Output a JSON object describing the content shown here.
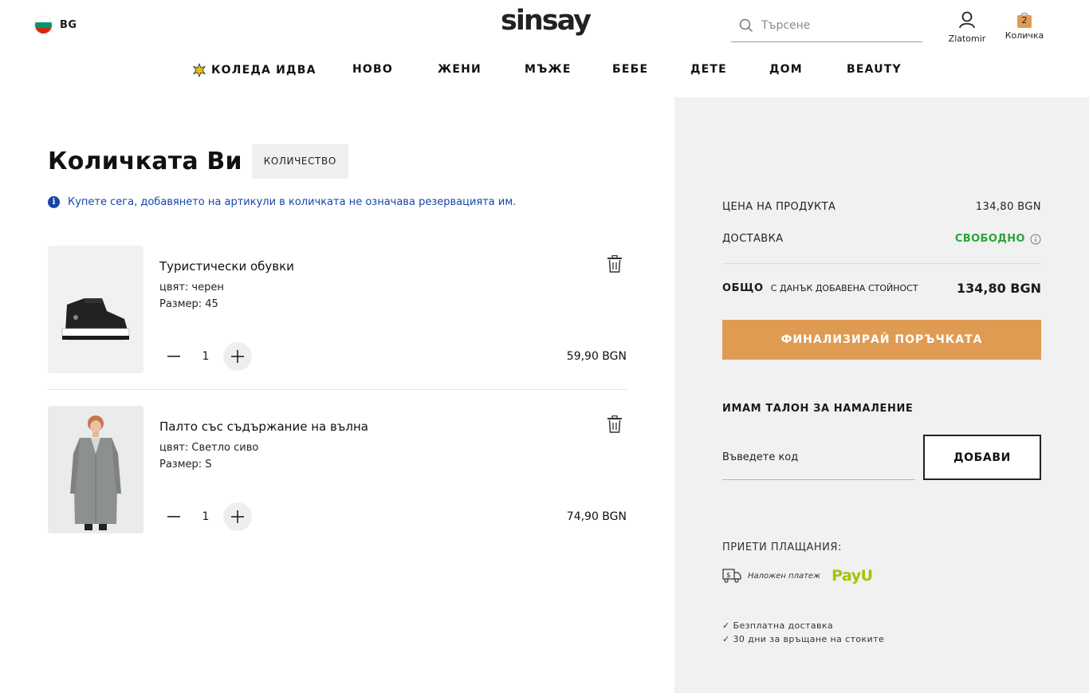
{
  "header": {
    "language": "BG",
    "logo": "sinsay",
    "search_placeholder": "Търсене",
    "account_label": "Zlatomir",
    "cart_label": "Количка",
    "cart_count": "2",
    "flag_colors": [
      "#ffffff",
      "#00966e",
      "#d62612"
    ]
  },
  "nav": {
    "items": [
      {
        "label": "КОЛЕДА ИДВА",
        "icon": "star-icon"
      },
      {
        "label": "НОВО"
      },
      {
        "label": "ЖЕНИ"
      },
      {
        "label": "МЪЖЕ"
      },
      {
        "label": "БЕБЕ"
      },
      {
        "label": "ДЕТЕ"
      },
      {
        "label": "ДОМ"
      },
      {
        "label": "BEAUTY"
      }
    ]
  },
  "cart": {
    "title": "Количката Ви",
    "quantity_badge": "КОЛИЧЕСТВО",
    "notice": "Купете сега, добавянето на артикули в количката не означава резервацията им.",
    "items": [
      {
        "name": "Туристически обувки",
        "color": "цвят: черен",
        "size": "Размер: 45",
        "quantity": "1",
        "price": "59,90 BGN",
        "image": "hiking-boot"
      },
      {
        "name": "Палто със съдържание на вълна",
        "color": "цвят: Светло сиво",
        "size": "Размер: S",
        "quantity": "1",
        "price": "74,90 BGN",
        "image": "grey-wool-coat"
      }
    ]
  },
  "summary": {
    "product_price_label": "ЦЕНА НА ПРОДУКТА",
    "product_price_value": "134,80 BGN",
    "delivery_label": "ДОСТАВКА",
    "delivery_value": "СВОБОДНО",
    "total_label": "ОБЩО",
    "total_note": "С ДАНЪК ДОБАВЕНА СТОЙНОСТ",
    "total_value": "134,80 BGN",
    "checkout_label": "ФИНАЛИЗИРАЙ ПОРЪЧКАТА",
    "coupon_title": "ИМАМ ТАЛОН ЗА НАМАЛЕНИЕ",
    "coupon_placeholder": "Въведете код",
    "coupon_add_label": "ДОБАВИ",
    "payments_title": "ПРИЕТИ ПЛАЩАНИЯ:",
    "cod_label": "Наложен платеж",
    "payu_label": "PayU",
    "perks": [
      "✓ Безплатна доставка",
      "✓ 30 дни за връщане на стоките"
    ],
    "accent_color": "#e09b53",
    "free_color": "#2aa53a"
  }
}
